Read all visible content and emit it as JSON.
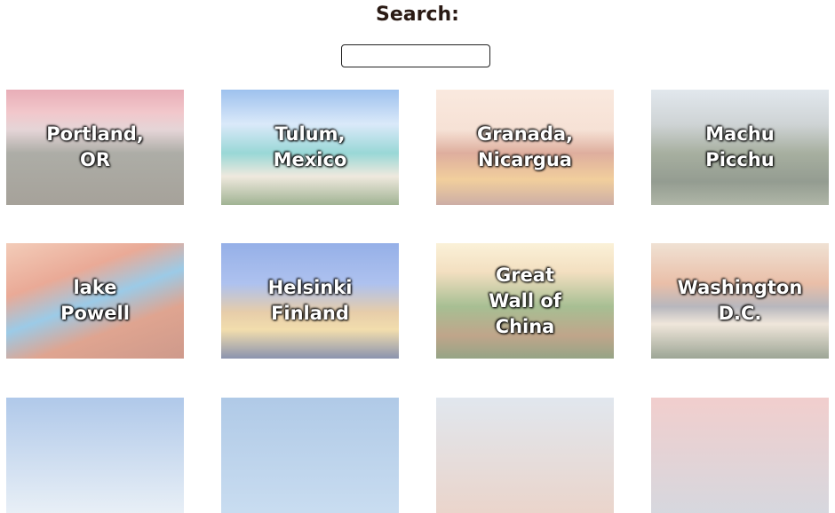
{
  "search": {
    "title": "Search:",
    "value": ""
  },
  "cards": [
    {
      "label": "Portland,\nOR"
    },
    {
      "label": "Tulum,\nMexico"
    },
    {
      "label": "Granada,\nNicargua"
    },
    {
      "label": "Machu\nPicchu"
    },
    {
      "label": "lake\nPowell"
    },
    {
      "label": "Helsinki\nFinland"
    },
    {
      "label": "Great\nWall of\nChina"
    },
    {
      "label": "Washington\nD.C."
    }
  ]
}
